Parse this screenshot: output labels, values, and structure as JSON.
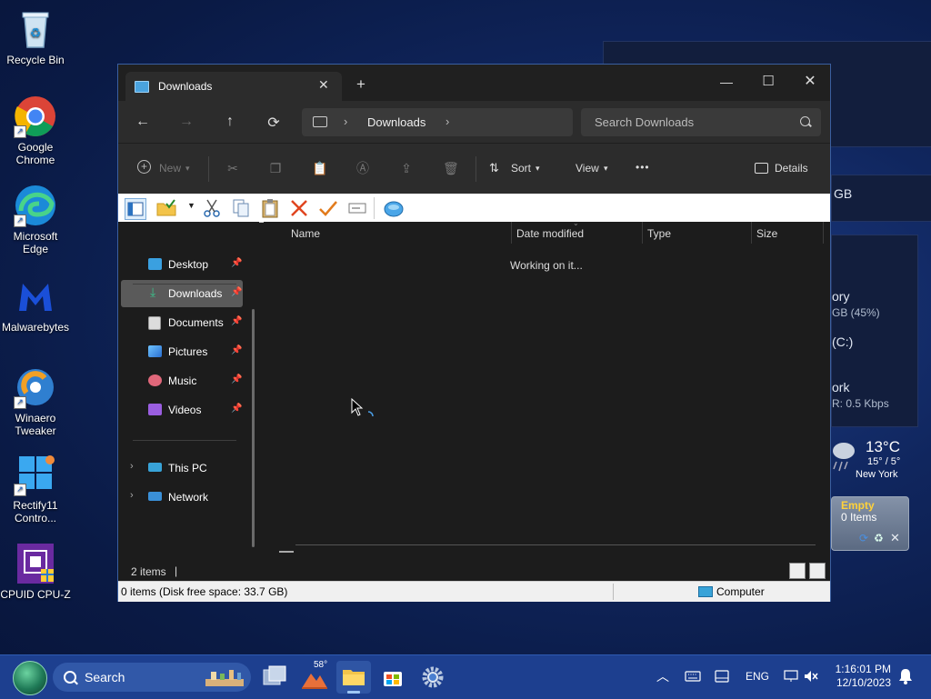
{
  "desktop": {
    "icons": [
      {
        "label": "Recycle Bin"
      },
      {
        "label": "Google Chrome"
      },
      {
        "label": "Microsoft Edge"
      },
      {
        "label": "Malwarebytes"
      },
      {
        "label": "Winaero Tweaker"
      },
      {
        "label": "Rectify11 Contro..."
      },
      {
        "label": "CPUID CPU-Z"
      }
    ],
    "widgets": {
      "disk_fragment": "GB",
      "memory_fragment": "ory",
      "memory_value": "GB (45%)",
      "drive_fragment": "(C:)",
      "network_fragment": "ork",
      "network_value": "R: 0.5 Kbps",
      "weather": {
        "temp": "13°C",
        "range": "15° / 5°",
        "city": "New York"
      },
      "recycle_gadget": {
        "status": "Empty",
        "items": "0 Items"
      }
    }
  },
  "window": {
    "tab": {
      "title": "Downloads",
      "close": "✕"
    },
    "new_tab": "+",
    "controls": {
      "minimize": "—",
      "maximize": "☐",
      "close": "✕"
    },
    "nav": {
      "back": "←",
      "forward": "→",
      "up": "↑",
      "refresh": "⟳"
    },
    "address": {
      "crumb": "Downloads"
    },
    "search": {
      "placeholder": "Search Downloads"
    },
    "commands": {
      "new": "New",
      "sort": "Sort",
      "view": "View",
      "more": "•••",
      "details": "Details"
    },
    "sidebar": {
      "quick_access": [
        {
          "label": "Desktop",
          "pinned": true,
          "color": "#3aa0e0"
        },
        {
          "label": "Downloads",
          "pinned": true,
          "color": "#3cc08a",
          "selected": true
        },
        {
          "label": "Documents",
          "pinned": true,
          "color": "#e0e0e0"
        },
        {
          "label": "Pictures",
          "pinned": true,
          "color": "#4a9ee6"
        },
        {
          "label": "Music",
          "pinned": true,
          "color": "#e0677a"
        },
        {
          "label": "Videos",
          "pinned": true,
          "color": "#9a5ee0"
        }
      ],
      "locations": [
        {
          "label": "This PC"
        },
        {
          "label": "Network"
        }
      ]
    },
    "columns": [
      "Name",
      "Date modified",
      "Type",
      "Size"
    ],
    "loading_text": "Working on it...",
    "status": {
      "item_count": "2 items"
    },
    "legacy_status": {
      "left": "0 items (Disk free space: 33.7 GB)",
      "right": "Computer"
    }
  },
  "taskbar": {
    "search_label": "Search",
    "weather_badge": "58°",
    "tray": {
      "language": "ENG"
    },
    "clock": {
      "time": "1:16:01 PM",
      "date": "12/10/2023"
    }
  }
}
